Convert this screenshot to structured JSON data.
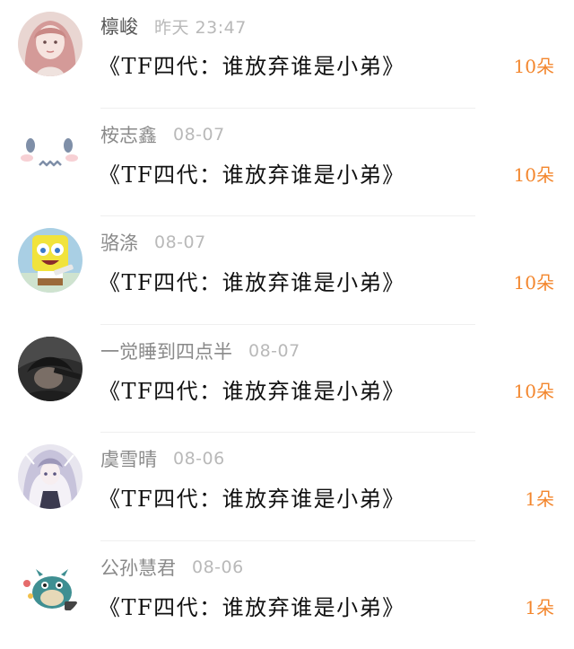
{
  "colors": {
    "background": "#ffffff",
    "name_text": "#8a8a8a",
    "time_text": "#b9b9b9",
    "title_text": "#111111",
    "gift_text": "#f3862d",
    "divider": "#efefef"
  },
  "entries": [
    {
      "name": "檩峻",
      "time": "昨天 23:47",
      "title": "《TF四代：谁放弃谁是小弟》",
      "gift": "10朵",
      "avatar_icon": "girl-pink-hair-avatar"
    },
    {
      "name": "桉志鑫",
      "time": "08-07",
      "title": "《TF四代：谁放弃谁是小弟》",
      "gift": "10朵",
      "avatar_icon": "cute-face-avatar"
    },
    {
      "name": "骆涤",
      "time": "08-07",
      "title": "《TF四代：谁放弃谁是小弟》",
      "gift": "10朵",
      "avatar_icon": "spongebob-avatar"
    },
    {
      "name": "一觉睡到四点半",
      "time": "08-07",
      "title": "《TF四代：谁放弃谁是小弟》",
      "gift": "10朵",
      "avatar_icon": "dark-photo-avatar"
    },
    {
      "name": "虞雪晴",
      "time": "08-06",
      "title": "《TF四代：谁放弃谁是小弟》",
      "gift": "1朵",
      "avatar_icon": "anime-girl-avatar"
    },
    {
      "name": "公孙慧君",
      "time": "08-06",
      "title": "《TF四代：谁放弃谁是小弟》",
      "gift": "1朵",
      "avatar_icon": "cartoon-monster-avatar"
    }
  ]
}
